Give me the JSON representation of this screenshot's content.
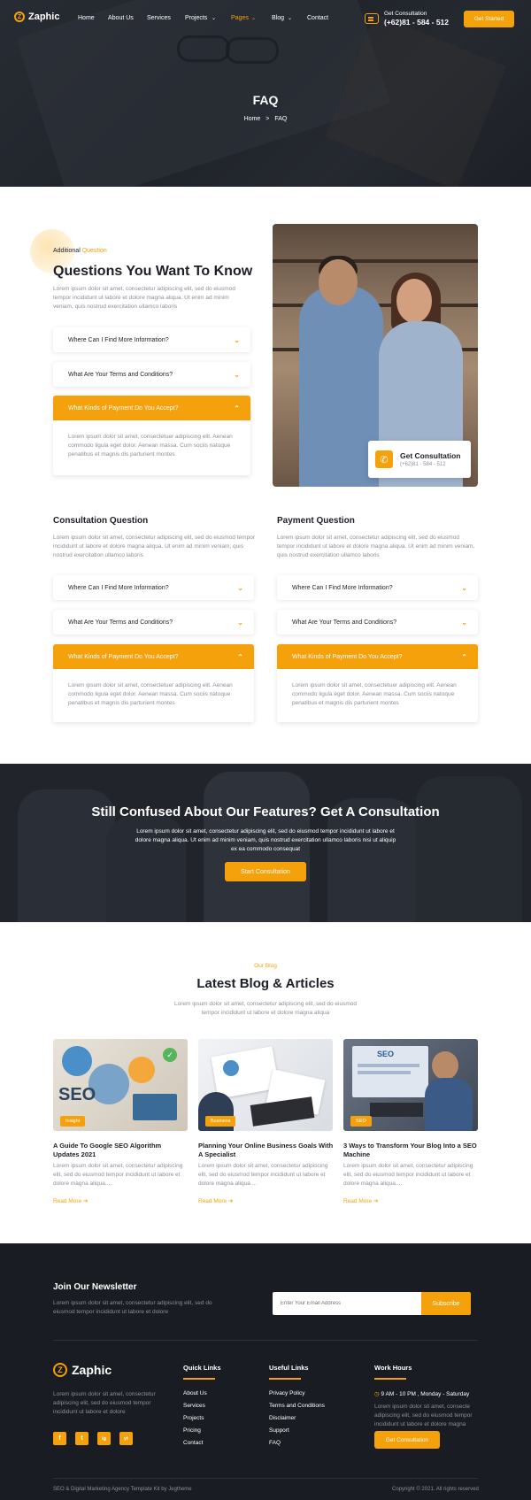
{
  "nav": {
    "brand": "Zaphic",
    "items": [
      {
        "label": "Home",
        "dropdown": false
      },
      {
        "label": "About Us",
        "dropdown": false
      },
      {
        "label": "Services",
        "dropdown": false
      },
      {
        "label": "Projects",
        "dropdown": true
      },
      {
        "label": "Pages",
        "dropdown": true,
        "active": true
      },
      {
        "label": "Blog",
        "dropdown": true
      },
      {
        "label": "Contact",
        "dropdown": false
      }
    ],
    "consult_label": "Get Consultation",
    "consult_phone": "(+62)81 - 584 - 512",
    "cta": "Get Started"
  },
  "hero": {
    "title": "FAQ",
    "breadcrumb_home": "Home",
    "breadcrumb_sep": ">",
    "breadcrumb_current": "FAQ"
  },
  "faq_main": {
    "eyebrow_a": "Additional",
    "eyebrow_b": "Question",
    "title": "Questions You Want To Know",
    "text": "Lorem ipsum dolor sit amet, consectetur adipiscing elit, sed do eiusmod tempor incididunt ut labore et dolore magna aliqua. Ut enim ad minim veniam, quis nostrud exercitation ullamco laboris",
    "items": [
      "Where Can I Find More Information?",
      "What Are Your Terms and Conditions?",
      "What Kinds of Payment Do You Accept?"
    ],
    "answer": "Lorem ipsum dolor sit amet, consectetuer adipiscing elit. Aenean commodo ligula eget dolor. Aenean massa. Cum sociis natoque penatibus et magnis dis parturient montes",
    "photo_card_title": "Get Consultation",
    "photo_card_phone": "(+62)81 - 584 - 512"
  },
  "consultation": {
    "title": "Consultation Question",
    "text": "Lorem ipsum dolor sit amet, consectetur adipiscing elit, sed do eiusmod tempor incididunt ut labore et dolore magna aliqua. Ut enim ad minim veniam, quis nostrud exercitation ullamco laboris",
    "items": [
      "Where Can I Find More Information?",
      "What Are Your Terms and Conditions?",
      "What Kinds of Payment Do You Accept?"
    ],
    "answer": "Lorem ipsum dolor sit amet, consectetuer adipiscing elit. Aenean commodo ligula eget dolor. Aenean massa. Cum sociis natoque penatibus et magnis dis parturient montes"
  },
  "payment": {
    "title": "Payment Question",
    "text": "Lorem ipsum dolor sit amet, consectetur adipiscing elit, sed do eiusmod tempor incididunt ut labore et dolore magna aliqua. Ut enim ad minim veniam, quis nostrud exercitation ullamco laboris",
    "items": [
      "Where Can I Find More Information?",
      "What Are Your Terms and Conditions?",
      "What Kinds of Payment Do You Accept?"
    ],
    "answer": "Lorem ipsum dolor sit amet, consectetuer adipiscing elit. Aenean commodo ligula eget dolor. Aenean massa. Cum sociis natoque penatibus et magnis dis parturient montes"
  },
  "cta_band": {
    "title": "Still Confused About Our Features? Get A Consultation",
    "text": "Lorem ipsum dolor sit amet, consectetur adipiscing elit, sed do eiusmod tempor incididunt ut labore et dolore magna aliqua. Ut enim ad minim veniam, quis nostrud exercitation ullamco laboris nisi ut aliquip ex ea commodo consequat",
    "button": "Start Consultation"
  },
  "blog": {
    "eyebrow": "Our Blog",
    "title": "Latest Blog & Articles",
    "text": "Lorem ipsum dolor sit amet, consectetur adipiscing elit, sed do eiusmod tempor incididunt ut labore et dolore magna aliqua",
    "posts": [
      {
        "tag": "Insight",
        "title": "A Guide To Google SEO Algorithm Updates 2021",
        "text": "Lorem ipsum dolor sit amet, consectetur adipiscing elit, sed do eiusmod tempor incididunt ut labore et dolore magna aliqua....",
        "link": "Read More"
      },
      {
        "tag": "Business",
        "title": "Planning Your Online Business Goals With A Specialist",
        "text": "Lorem ipsum dolor sit amet, consectetur adipiscing elit, sed do eiusmod tempor incididunt ut labore et dolore magna aliqua....",
        "link": "Read More"
      },
      {
        "tag": "SEO",
        "title": "3 Ways to Transform Your Blog Into a SEO Machine",
        "text": "Lorem ipsum dolor sit amet, consectetur adipiscing elit, sed do eiusmod tempor incididunt ut labore et dolore magna aliqua....",
        "link": "Read More"
      }
    ],
    "img_seo_text": "SEO"
  },
  "newsletter": {
    "title": "Join Our Newsletter",
    "text": "Lorem ipsum dolor sit amet, consectetur adipiscing elit, sed do eiusmod tempor incididunt ut labore et dolore",
    "placeholder": "Enter Your Email Address",
    "button": "Subscribe"
  },
  "footer": {
    "brand": "Zaphic",
    "about": "Lorem ipsum dolor sit amet, consectetur adipiscing elit, sed do eiusmod tempor incididunt ut labore et dolore",
    "social": [
      "f",
      "t",
      "ig",
      "yt"
    ],
    "quick_title": "Quick Links",
    "quick_links": [
      "About Us",
      "Services",
      "Projects",
      "Pricing",
      "Contact"
    ],
    "useful_title": "Useful Links",
    "useful_links": [
      "Privacy Policy",
      "Terms and Conditions",
      "Disclaimer",
      "Support",
      "FAQ"
    ],
    "hours_title": "Work Hours",
    "hours": "9 AM - 10 PM , Monday - Saturday",
    "hours_text": "Lorem ipsum dolor sit amet, consecte adipiscing elit, sed do eiusmod tempor incididunt ut labore et dolore magna",
    "hours_button": "Get Consultation",
    "credit": "SEO & Digital Marketing Agency Template Kit by Jegtheme",
    "copyright": "Copyright © 2021. All rights reserved"
  },
  "colors": {
    "accent": "#f5a10c",
    "dark": "#191c22",
    "text": "#1c1f26",
    "muted": "#8b8f98"
  }
}
